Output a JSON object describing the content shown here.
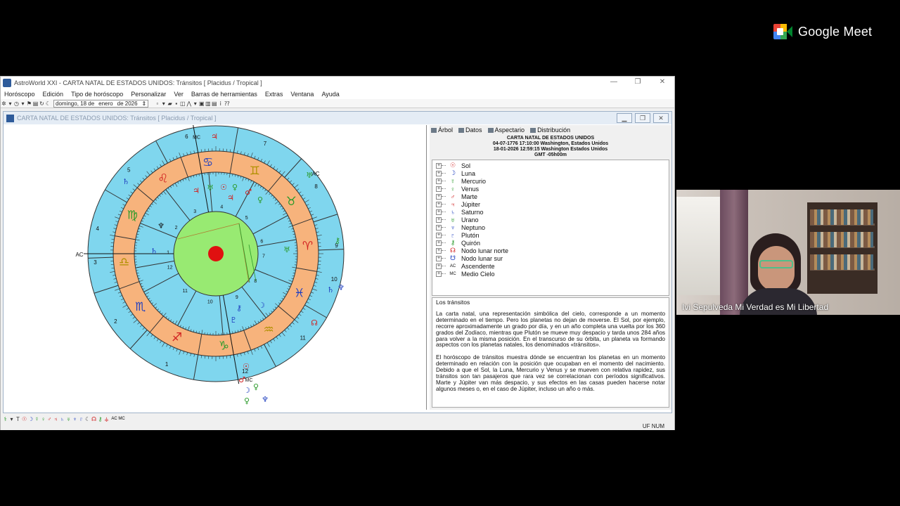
{
  "meet": {
    "brand": "Google Meet",
    "participant_name": "Ivi Sepulveda Mi Verdad es Mi Libertad"
  },
  "window": {
    "title": "AstroWorld XXI - CARTA NATAL DE ESTADOS UNIDOS: Tránsitos [ Placidus / Tropical ]",
    "controls": {
      "minimize": "—",
      "restore": "❐",
      "close": "✕"
    }
  },
  "menu": [
    "Horóscopo",
    "Edición",
    "Tipo de horóscopo",
    "Personalizar",
    "Ver",
    "Barras de herramientas",
    "Extras",
    "Ventana",
    "Ayuda"
  ],
  "toolbar": {
    "date_day": "domingo, 18 de",
    "date_month": "enero",
    "date_year": "de 2026"
  },
  "child": {
    "title": "CARTA NATAL DE ESTADOS UNIDOS: Tránsitos [ Placidus / Tropical ]"
  },
  "panel": {
    "tabs": [
      "Árbol",
      "Datos",
      "Aspectario",
      "Distribución"
    ],
    "header": [
      "CARTA NATAL DE ESTADOS UNIDOS",
      "04-07-1776 17:10:00 Washington, Estados Unidos",
      "18-01-2026 12:59:15 Washington Estados Unidos",
      "GMT -05h00m"
    ],
    "tree": [
      {
        "glyph": "☉",
        "label": "Sol",
        "color": "#d02020"
      },
      {
        "glyph": "☽",
        "label": "Luna",
        "color": "#2040c0"
      },
      {
        "glyph": "☿",
        "label": "Mercurio",
        "color": "#2a9a2a"
      },
      {
        "glyph": "♀",
        "label": "Venus",
        "color": "#2a9a2a"
      },
      {
        "glyph": "♂",
        "label": "Marte",
        "color": "#d02020"
      },
      {
        "glyph": "♃",
        "label": "Júpiter",
        "color": "#d02020"
      },
      {
        "glyph": "♄",
        "label": "Saturno",
        "color": "#2040c0"
      },
      {
        "glyph": "♅",
        "label": "Urano",
        "color": "#2a9a2a"
      },
      {
        "glyph": "♆",
        "label": "Neptuno",
        "color": "#2040c0"
      },
      {
        "glyph": "♇",
        "label": "Plutón",
        "color": "#2040c0"
      },
      {
        "glyph": "⚷",
        "label": "Quirón",
        "color": "#2a9a2a"
      },
      {
        "glyph": "☊",
        "label": "Nodo lunar norte",
        "color": "#d02020"
      },
      {
        "glyph": "☋",
        "label": "Nodo lunar sur",
        "color": "#2040c0"
      },
      {
        "glyph": "AC",
        "label": "Ascendente",
        "color": "#111111"
      },
      {
        "glyph": "MC",
        "label": "Medio Cielo",
        "color": "#111111"
      }
    ],
    "text_title": "Los tránsitos",
    "paragraphs": [
      "La carta natal, una representación simbólica del cielo, corresponde a un momento determinado en el tiempo. Pero los planetas no dejan de moverse. El Sol, por ejemplo, recorre aproximadamente un grado por día, y en un año completa una vuelta por los 360 grados del Zodíaco, mientras que Plutón se mueve muy despacio y tarda unos 284 años para volver a la misma posición. En el transcurso de su órbita, un planeta va formando aspectos con los planetas natales, los denominados «tránsitos».",
      "El horóscopo de tránsitos muestra dónde se encuentran los planetas en un momento determinado en relación con la posición que ocupaban en el momento del nacimiento. Debido a que el Sol, la Luna, Mercurio y Venus y se mueven con relativa rapidez, sus tránsitos son tan pasajeros que rara vez se correlacionan con períodos significativos. Marte y Júpiter van más despacio, y sus efectos en las casas pueden hacerse notar algunos meses o, en el caso de Júpiter, incluso un año o más."
    ]
  },
  "chart": {
    "signs": [
      {
        "glyph": "♋",
        "color": "#2040c0"
      },
      {
        "glyph": "♊",
        "color": "#b09000"
      },
      {
        "glyph": "♉",
        "color": "#2a9a2a"
      },
      {
        "glyph": "♈",
        "color": "#d02020"
      },
      {
        "glyph": "♓",
        "color": "#2040c0"
      },
      {
        "glyph": "♒",
        "color": "#b09000"
      },
      {
        "glyph": "♑",
        "color": "#2a9a2a"
      },
      {
        "glyph": "♐",
        "color": "#d02020"
      },
      {
        "glyph": "♏",
        "color": "#2040c0"
      },
      {
        "glyph": "♎",
        "color": "#b09000"
      },
      {
        "glyph": "♍",
        "color": "#2a9a2a"
      },
      {
        "glyph": "♌",
        "color": "#d02020"
      }
    ],
    "outer_houses": [
      "1",
      "2",
      "3",
      "4",
      "5",
      "6",
      "7",
      "8",
      "9",
      "10",
      "11",
      "12"
    ],
    "inner_houses": [
      "1",
      "2",
      "3",
      "4",
      "5",
      "6",
      "7",
      "8",
      "9",
      "10",
      "11",
      "12"
    ],
    "ac_label": "AC",
    "mc_label": "MC",
    "colors": {
      "outer_ring": "#7fd6ee",
      "zodiac_ring": "#f7b37c",
      "inner_ring": "#7fd6ee",
      "center": "#98ea72",
      "center_dot": "#e01010"
    }
  },
  "statusbar": {
    "right": "UF  NUM"
  }
}
